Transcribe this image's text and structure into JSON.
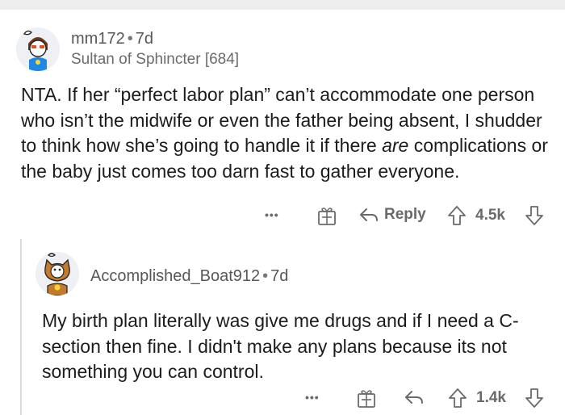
{
  "comments": [
    {
      "username": "mm172",
      "age": "7d",
      "flair": "Sultan of Sphincter [684]",
      "body_before": "NTA.  If her “perfect labor plan” can’t accommodate one person who isn’t the midwife or even the father being absent, I shudder to think how she’s going to handle it if there ",
      "body_emph": "are",
      "body_after": " complications or the baby just comes too darn fast to gather everyone.",
      "more_label": "•••",
      "reply_label": "Reply",
      "upvotes": "4.5k"
    },
    {
      "username": "Accomplished_Boat912",
      "age": "7d",
      "body": "My birth plan literally was give me drugs and if I need a C-section then fine. I didn't make any plans because its not something you can control.",
      "more_label": "•••",
      "upvotes": "1.4k"
    }
  ],
  "separator": "•",
  "colors": {
    "text": "#1c1c1c",
    "meta": "#575757",
    "icon": "#6a6a6a",
    "thread_line": "#dcdcdc"
  },
  "icons": [
    "more-icon",
    "gift-award-icon",
    "reply-arrow-icon",
    "upvote-icon",
    "downvote-icon"
  ]
}
